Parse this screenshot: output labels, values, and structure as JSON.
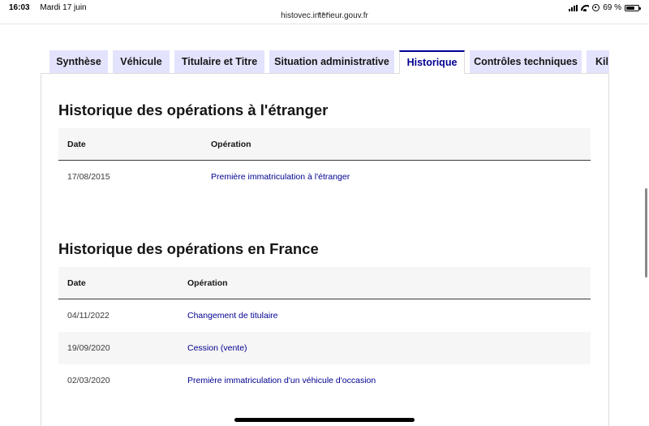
{
  "status_bar": {
    "time": "16:03",
    "date": "Mardi 17 juin",
    "url": "histovec.interieur.gouv.fr",
    "battery_label": "69 %",
    "battery_level": 0.69
  },
  "tabs": [
    {
      "label": "Synthèse",
      "active": false
    },
    {
      "label": "Véhicule",
      "active": false
    },
    {
      "label": "Titulaire et Titre",
      "active": false
    },
    {
      "label": "Situation administrative",
      "active": false
    },
    {
      "label": "Historique",
      "active": true
    },
    {
      "label": "Contrôles techniques",
      "active": false
    },
    {
      "label": "Kil",
      "active": false
    }
  ],
  "foreign_history": {
    "title": "Historique des opérations à l'étranger",
    "col_date": "Date",
    "col_operation": "Opération",
    "rows": [
      {
        "date": "17/08/2015",
        "operation": "Première immatriculation à l'étranger"
      }
    ]
  },
  "france_history": {
    "title": "Historique des opérations en France",
    "col_date": "Date",
    "col_operation": "Opération",
    "rows": [
      {
        "date": "04/11/2022",
        "operation": "Changement de titulaire"
      },
      {
        "date": "19/09/2020",
        "operation": "Cession (vente)"
      },
      {
        "date": "02/03/2020",
        "operation": "Première immatriculation d'un véhicule d'occasion"
      }
    ]
  },
  "colors": {
    "accent": "#000091",
    "tab_background": "#e3e3fd",
    "header_background": "#f6f6f6"
  }
}
